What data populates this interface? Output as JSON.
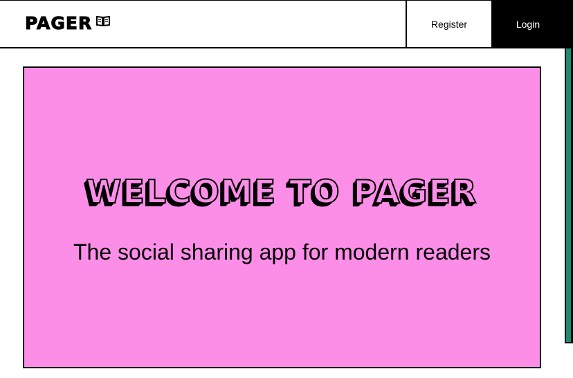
{
  "header": {
    "logo_text": "PAGER",
    "logo_icon": "book-icon",
    "nav": {
      "register_label": "Register",
      "login_label": "Login"
    }
  },
  "hero": {
    "title": "WELCOME TO PAGER",
    "subtitle": "The social sharing app for modern readers"
  },
  "colors": {
    "hero_background": "#fc8ee8",
    "login_background": "#000000",
    "scrollbar_thumb": "#1f8a72"
  }
}
